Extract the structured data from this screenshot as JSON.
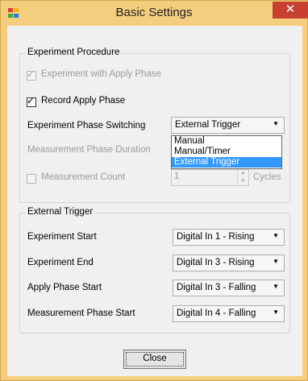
{
  "window": {
    "title": "Basic Settings",
    "close_glyph": "✕",
    "app_icon": "app-grid-icon"
  },
  "experiment_procedure": {
    "caption": "Experiment Procedure",
    "apply_phase_checkbox": {
      "label": "Experiment with Apply Phase",
      "checked": true,
      "enabled": false
    },
    "record_apply_phase_checkbox": {
      "label": "Record Apply Phase",
      "checked": true,
      "enabled": true
    },
    "phase_switching": {
      "label": "Experiment Phase Switching",
      "selected": "External Trigger",
      "options": [
        "Manual",
        "Manual/Timer",
        "External Trigger"
      ]
    },
    "measurement_phase_duration": {
      "label": "Measurement Phase Duration",
      "enabled": false
    },
    "measurement_count": {
      "label": "Measurement Count",
      "checked": false,
      "enabled": false,
      "value": "1",
      "unit": "Cycles"
    }
  },
  "external_trigger": {
    "caption": "External Trigger",
    "rows": [
      {
        "label": "Experiment Start",
        "value": "Digital In 1 - Rising"
      },
      {
        "label": "Experiment End",
        "value": "Digital In 3 - Rising"
      },
      {
        "label": "Apply Phase Start",
        "value": "Digital In 3 - Falling"
      },
      {
        "label": "Measurement Phase Start",
        "value": "Digital In 4 - Falling"
      }
    ]
  },
  "footer": {
    "close_label": "Close"
  },
  "glyphs": {
    "check": "✓",
    "dropdown_arrow": "▼",
    "spin_up": "▲",
    "spin_down": "▼"
  },
  "colors": {
    "title_bar": "#f4ce7e",
    "close_button": "#c84031",
    "selection": "#3399ff",
    "client": "#f0f0f0"
  }
}
